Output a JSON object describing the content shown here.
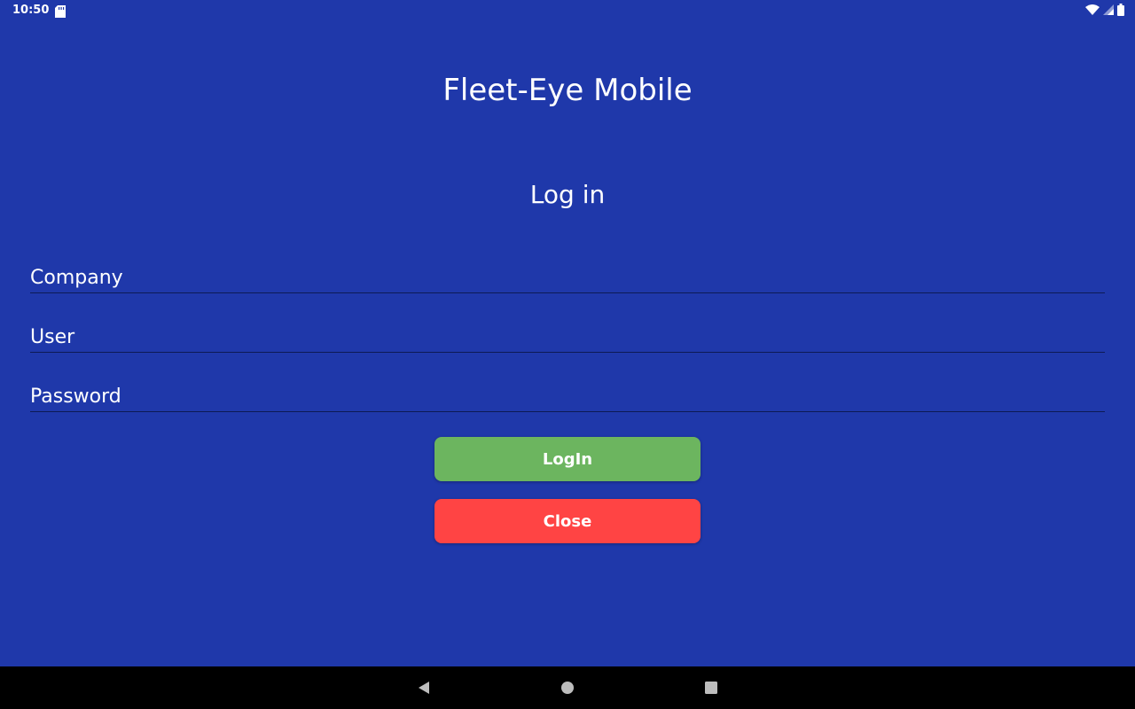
{
  "status_bar": {
    "time": "10:50",
    "icons": [
      "sd-card-icon",
      "wifi-icon",
      "signal-icon",
      "battery-icon"
    ]
  },
  "app": {
    "title": "Fleet-Eye Mobile"
  },
  "form": {
    "title": "Log in",
    "fields": {
      "company": {
        "placeholder": "Company",
        "value": ""
      },
      "user": {
        "placeholder": "User",
        "value": ""
      },
      "password": {
        "placeholder": "Password",
        "value": ""
      }
    },
    "buttons": {
      "login_label": "LogIn",
      "close_label": "Close"
    }
  },
  "colors": {
    "background": "#1F38AA",
    "login_button": "#6CB55F",
    "close_button": "#FF4444",
    "nav_bar": "#000000"
  },
  "nav_bar": {
    "icons": [
      "back-icon",
      "home-icon",
      "recents-icon"
    ]
  }
}
